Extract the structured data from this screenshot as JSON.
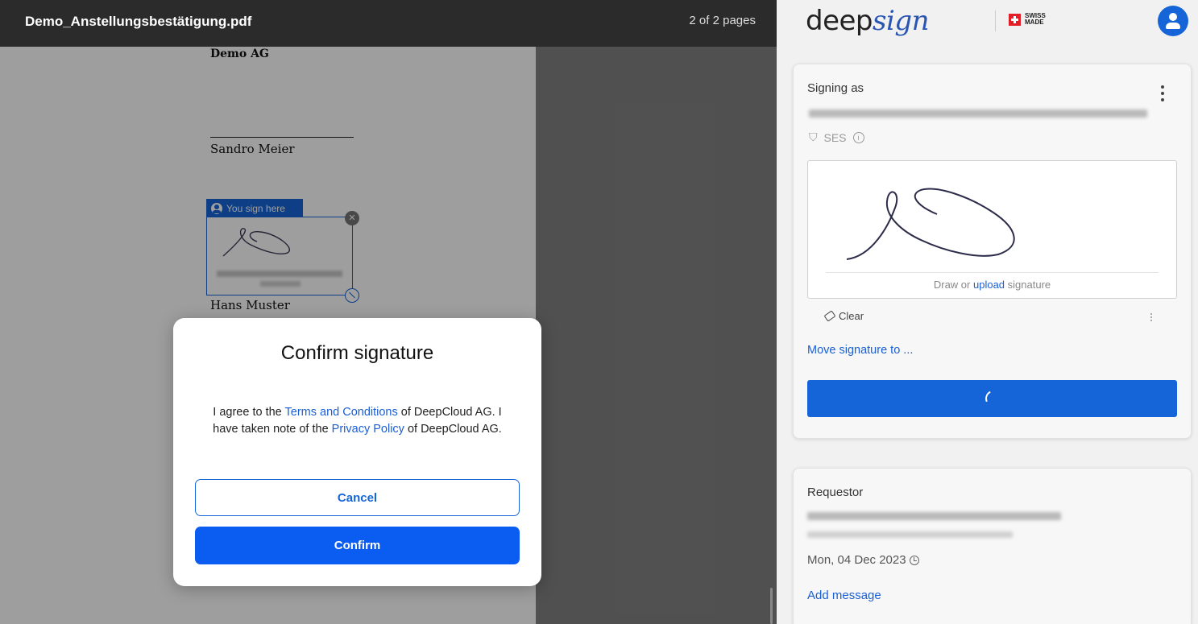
{
  "viewer": {
    "filename": "Demo_Anstellungsbestätigung.pdf",
    "page_count": "2 of 2 pages"
  },
  "document": {
    "company": "Demo AG",
    "signer_1": "Sandro Meier",
    "signer_2": "Hans Muster",
    "sign_tag": "You sign here"
  },
  "modal": {
    "title": "Confirm signature",
    "text_1": "I agree to the ",
    "terms_link": "Terms and Conditions",
    "text_2": " of DeepCloud AG. I have taken note of the ",
    "privacy_link": "Privacy Policy",
    "text_3": " of DeepCloud AG.",
    "cancel": "Cancel",
    "confirm": "Confirm"
  },
  "sidebar": {
    "logo_a": "deep",
    "logo_b": "sign",
    "swiss_1": "SWISS",
    "swiss_2": "MADE",
    "signing_as": "Signing as",
    "level": "SES",
    "pad_hint_1": "Draw or ",
    "pad_hint_link": "upload",
    "pad_hint_2": " signature",
    "clear": "Clear",
    "move": "Move signature to ...",
    "requestor": "Requestor",
    "date": "Mon, 04 Dec 2023",
    "add_message": "Add message"
  },
  "colors": {
    "accent": "#1565d8",
    "confirm_button": "#0b5cf0",
    "topbar": "#2b2b2b"
  }
}
